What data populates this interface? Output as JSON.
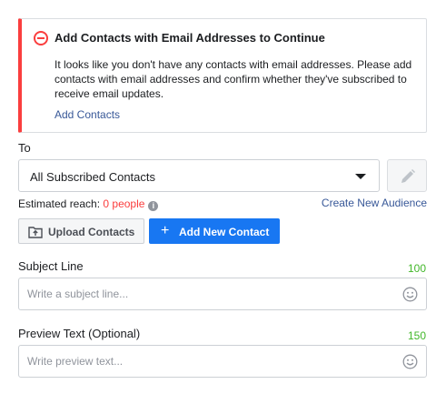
{
  "alert": {
    "title": "Add Contacts with Email Addresses to Continue",
    "body": "It looks like you don't have any contacts with email addresses. Please add contacts with email addresses and confirm whether they've subscribed to receive email updates.",
    "link": "Add Contacts",
    "icon": "minus-circle-icon",
    "accent": "#fa3e3e"
  },
  "audience": {
    "label": "To",
    "selected": "All Subscribed Contacts",
    "edit_icon": "pencil-icon"
  },
  "reach": {
    "label": "Estimated reach:",
    "value": "0 people",
    "info_icon": "i",
    "create_link": "Create New Audience"
  },
  "actions": {
    "upload_label": "Upload Contacts",
    "add_label": "Add New Contact",
    "add_icon": "+",
    "primary_color": "#1877f2"
  },
  "subject": {
    "label": "Subject Line",
    "counter": "100",
    "placeholder": "Write a subject line...",
    "value": ""
  },
  "preview": {
    "label": "Preview Text (Optional)",
    "counter": "150",
    "placeholder": "Write preview text...",
    "value": ""
  }
}
